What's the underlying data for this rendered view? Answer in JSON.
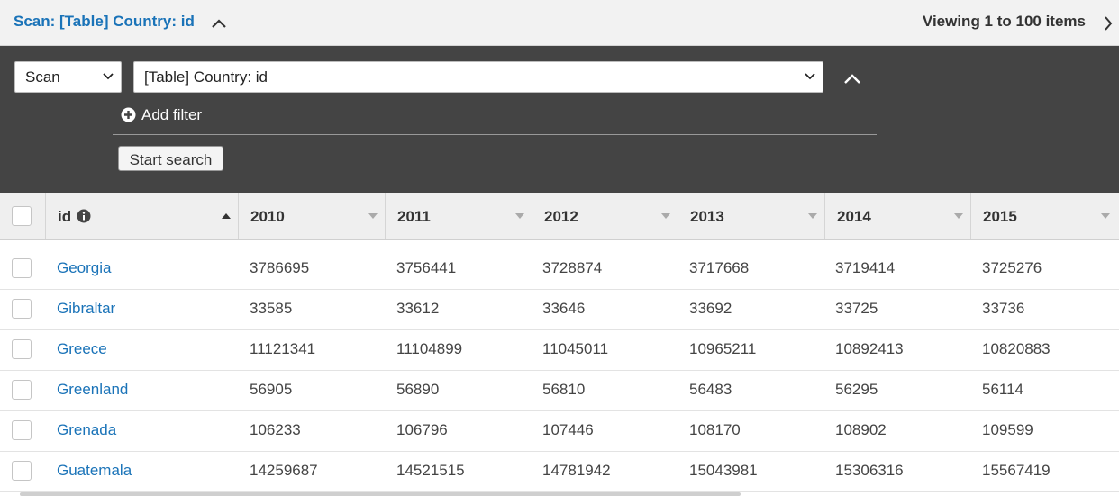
{
  "header": {
    "title": "Scan: [Table] Country: id",
    "viewing": "Viewing 1 to 100 items"
  },
  "search": {
    "mode": "Scan",
    "target": "[Table] Country: id",
    "add_filter": "Add filter",
    "start_search": "Start search"
  },
  "table": {
    "columns": [
      "id",
      "2010",
      "2011",
      "2012",
      "2013",
      "2014",
      "2015"
    ],
    "rows": [
      [
        "Georgia",
        "3786695",
        "3756441",
        "3728874",
        "3717668",
        "3719414",
        "3725276"
      ],
      [
        "Gibraltar",
        "33585",
        "33612",
        "33646",
        "33692",
        "33725",
        "33736"
      ],
      [
        "Greece",
        "11121341",
        "11104899",
        "11045011",
        "10965211",
        "10892413",
        "10820883"
      ],
      [
        "Greenland",
        "56905",
        "56890",
        "56810",
        "56483",
        "56295",
        "56114"
      ],
      [
        "Grenada",
        "106233",
        "106796",
        "107446",
        "108170",
        "108902",
        "109599"
      ],
      [
        "Guatemala",
        "14259687",
        "14521515",
        "14781942",
        "15043981",
        "15306316",
        "15567419"
      ]
    ]
  },
  "colors": {
    "link": "#1a73b8",
    "panel": "#444444"
  }
}
